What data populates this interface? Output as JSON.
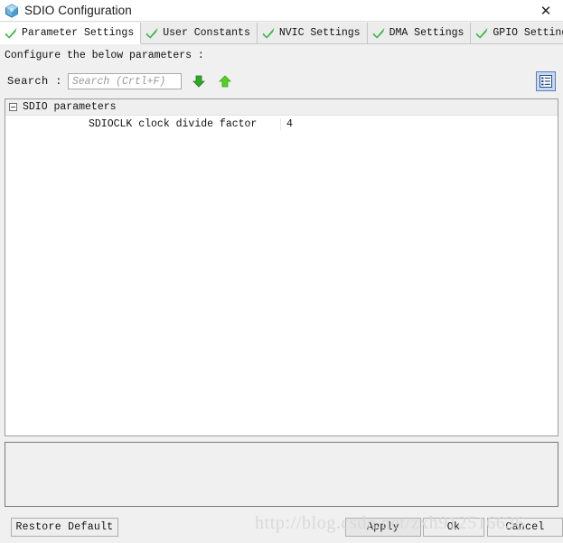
{
  "window": {
    "title": "SDIO Configuration",
    "app_icon": "cube-icon",
    "close_label": "✕"
  },
  "tabs": [
    {
      "label": "Parameter Settings",
      "icon": "green-check-icon",
      "active": true
    },
    {
      "label": "User Constants",
      "icon": "green-check-icon",
      "active": false
    },
    {
      "label": "NVIC Settings",
      "icon": "green-check-icon",
      "active": false
    },
    {
      "label": "DMA Settings",
      "icon": "green-check-icon",
      "active": false
    },
    {
      "label": "GPIO Settings",
      "icon": "green-check-icon",
      "active": false
    }
  ],
  "main": {
    "instruction": "Configure the below parameters :",
    "search": {
      "label": "Search :",
      "placeholder": "Search (Crtl+F)",
      "value": "",
      "find_next_icon": "arrow-down-icon",
      "find_prev_icon": "arrow-up-icon"
    },
    "view_toggle": {
      "icon": "list-view-icon",
      "active": true
    },
    "tree": {
      "group": {
        "label": "SDIO parameters",
        "expanded": true,
        "expander_icon": "collapse-box-icon"
      },
      "rows": [
        {
          "name": "SDIOCLK clock divide factor",
          "value": "4"
        }
      ]
    },
    "description": {
      "text": ""
    }
  },
  "footer": {
    "restore_label": "Restore Default",
    "apply_label": "Apply",
    "ok_label": "Ok",
    "cancel_label": "Cancel"
  },
  "watermark": {
    "text": "http://blog.csdn.net/zxh912516636"
  },
  "colors": {
    "accent_blue": "#5b7fb5",
    "check_green": "#3cb54a",
    "arrow_down_green": "#34b233",
    "arrow_up_green": "#5bd12a",
    "window_bg": "#f0f0f0",
    "panel_white": "#ffffff"
  }
}
